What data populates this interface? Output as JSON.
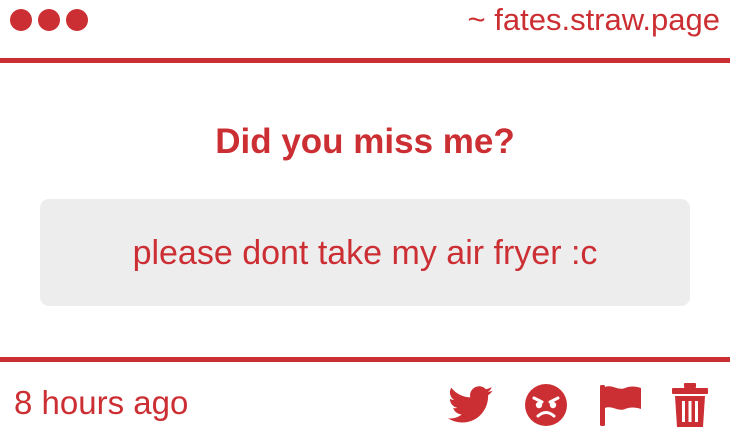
{
  "header": {
    "window_dots": [
      "dot",
      "dot",
      "dot"
    ],
    "domain": "~ fates.straw.page"
  },
  "card": {
    "question": "Did you miss me?",
    "answer": "please dont take my air fryer :c",
    "timestamp": "8 hours ago"
  },
  "actions": [
    {
      "name": "twitter-share",
      "icon": "twitter-bird-icon"
    },
    {
      "name": "react",
      "icon": "angry-face-icon"
    },
    {
      "name": "report",
      "icon": "flag-icon"
    },
    {
      "name": "delete",
      "icon": "trash-icon"
    }
  ],
  "colors": {
    "accent": "#cc2f33",
    "answer_bg": "#eeedee",
    "background": "#ffffff"
  }
}
